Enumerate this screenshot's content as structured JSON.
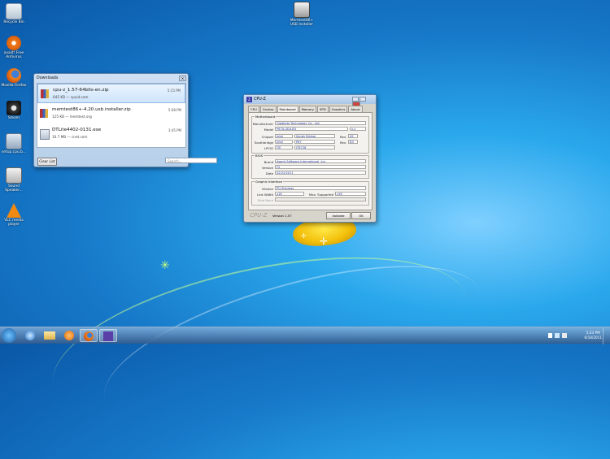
{
  "desktop": {
    "icons": [
      {
        "label": "Recycle Bin",
        "icon": "recycle-bin-icon"
      },
      {
        "label": "avast! Free Antivirus",
        "icon": "avast-icon"
      },
      {
        "label": "Mozilla Firefox",
        "icon": "firefox-icon"
      },
      {
        "label": "Steam",
        "icon": "steam-icon"
      },
      {
        "label": "setup.cpu.b...",
        "icon": "setup-file-icon"
      },
      {
        "label": "Sound Speaker...",
        "icon": "speaker-icon"
      },
      {
        "label": "VLC media player",
        "icon": "vlc-icon"
      }
    ],
    "memtest_icon": {
      "label": "Memtest86+ USB Installer",
      "icon": "usb-installer-icon"
    }
  },
  "downloads": {
    "title": "Downloads",
    "items": [
      {
        "name": "cpu-z_1.57-64bits-en.zip",
        "meta": "645 KB — cpuid.com",
        "time": "5:15 PM"
      },
      {
        "name": "memtest86+-4.20.usb.installer.zip",
        "meta": "125 KB — memtest.org",
        "time": "5:08 PM"
      },
      {
        "name": "DTLite4402-0131.exe",
        "meta": "10.7 MB — cnet.com",
        "time": "3:45 PM"
      }
    ],
    "clear_label": "Clear List",
    "search_placeholder": "Search..."
  },
  "cpuz": {
    "title": "CPU-Z",
    "tabs": [
      "CPU",
      "Caches",
      "Mainboard",
      "Memory",
      "SPD",
      "Graphics",
      "About"
    ],
    "active_tab": "Mainboard",
    "motherboard": {
      "group": "Motherboard",
      "manufacturer_label": "Manufacturer",
      "manufacturer": "Gigabyte Technology Co., Ltd.",
      "model_label": "Model",
      "model": "P67A-UD4-B3",
      "model_rev": "x.x",
      "chipset_label": "Chipset",
      "chipset_vendor": "Intel",
      "chipset_name": "Sandy Bridge",
      "chipset_rev_label": "Rev.",
      "chipset_rev": "09",
      "southbridge_label": "Southbridge",
      "southbridge_vendor": "Intel",
      "southbridge_name": "P67",
      "southbridge_rev_label": "Rev.",
      "southbridge_rev": "B3",
      "lpcio_label": "LPCIO",
      "lpcio_vendor": "ITE",
      "lpcio_name": "IT8728"
    },
    "bios": {
      "group": "BIOS",
      "brand_label": "Brand",
      "brand": "Award Software International, Inc.",
      "version_label": "Version",
      "version": "F2",
      "date_label": "Date",
      "date": "02/22/2011"
    },
    "graphic_interface": {
      "group": "Graphic Interface",
      "version_label": "Version",
      "version": "PCI-Express",
      "link_width_label": "Link Width",
      "link_width": "x16",
      "max_supported_label": "Max. Supported",
      "max_supported": "x16",
      "side_band_label": "Side Band"
    },
    "brand_mark": "CPU-Z",
    "version_text": "Version 1.57",
    "validate_label": "Validate",
    "ok_label": "OK"
  },
  "taskbar": {
    "clock_time": "5:23 PM",
    "clock_date": "6/18/2011"
  },
  "colors": {
    "field_text": "#22339b",
    "accent": "#3d3da8"
  }
}
